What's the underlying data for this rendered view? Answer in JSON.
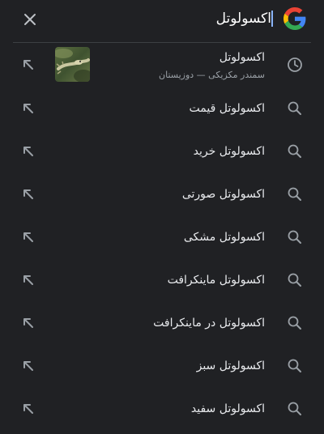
{
  "search": {
    "query": "اکسولوتل"
  },
  "suggestions": [
    {
      "label": "اکسولوتل",
      "sublabel": "سمندر مکزیکی — دوزیستان",
      "icon": "history-icon",
      "thumbnail": "axolotl-thumbnail"
    },
    {
      "label": "اکسولوتل قیمت",
      "icon": "search-icon"
    },
    {
      "label": "اکسولوتل خرید",
      "icon": "search-icon"
    },
    {
      "label": "اکسولوتل صورتی",
      "icon": "search-icon"
    },
    {
      "label": "اکسولوتل مشکی",
      "icon": "search-icon"
    },
    {
      "label": "اکسولوتل ماینکرافت",
      "icon": "search-icon"
    },
    {
      "label": "اکسولوتل در ماینکرافت",
      "icon": "search-icon"
    },
    {
      "label": "اکسولوتل سبز",
      "icon": "search-icon"
    },
    {
      "label": "اکسولوتل سفید",
      "icon": "search-icon"
    }
  ],
  "colors": {
    "background": "#202124",
    "text": "#e8eaed",
    "secondary_text": "#9aa0a6",
    "icon": "#9aa0a6",
    "caret": "#8ab4f8"
  }
}
